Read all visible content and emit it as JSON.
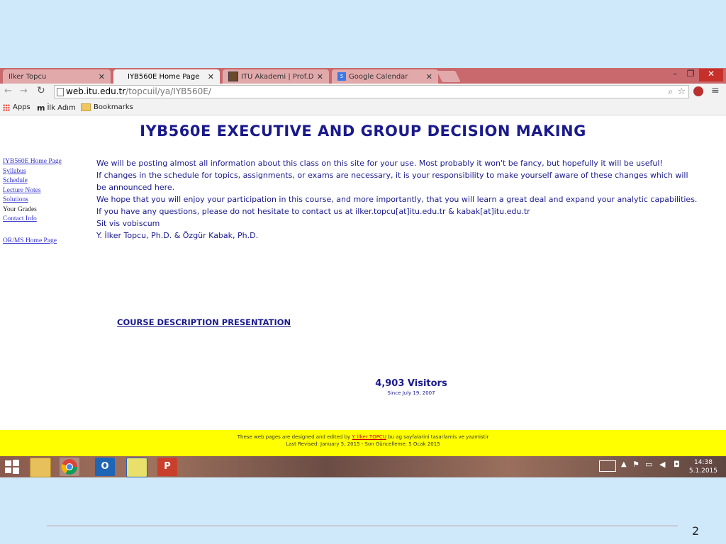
{
  "browser": {
    "tabs": [
      {
        "title": "Ilker Topcu",
        "active": false
      },
      {
        "title": "IYB560E Home Page",
        "active": true
      },
      {
        "title": "İTÜ Akademi | Prof.Dr. İlker",
        "active": false
      },
      {
        "title": "Google Calendar",
        "active": false
      }
    ],
    "address_host": "web.itu.edu.tr",
    "address_path": "/topcuil/ya/IYB560E/",
    "bookmarks": [
      "Apps",
      "İlk Adım",
      "Bookmarks"
    ]
  },
  "page": {
    "heading": "IYB560E EXECUTIVE AND GROUP DECISION MAKING",
    "nav": [
      {
        "label": "IYB560E Home Page",
        "link": true
      },
      {
        "label": "Syllabus",
        "link": true
      },
      {
        "label": "Schedule",
        "link": true
      },
      {
        "label": "Lecture Notes",
        "link": true
      },
      {
        "label": "Solutions",
        "link": true
      },
      {
        "label": "Your Grades",
        "link": false
      },
      {
        "label": "Contact Info",
        "link": true
      }
    ],
    "nav_home": "OR/MS Home Page",
    "paragraphs": [
      "We will be posting almost all information about this class on this site for your use. Most probably it won't be fancy, but hopefully it will be useful!",
      "If changes in the schedule for topics, assignments, or exams are necessary, it is your responsibility to make yourself aware of these changes which will be announced here.",
      "We hope that you will enjoy your participation in this course, and more importantly, that you will learn a great deal and expand your analytic capabilities.",
      "If you have any questions, please do not hesitate to contact us at ilker.topcu[at]itu.edu.tr & kabak[at]itu.edu.tr",
      "Sit vis vobiscum",
      "Y. İlker Topcu, Ph.D. & Özgür Kabak, Ph.D."
    ],
    "course_link": "COURSE DESCRIPTION PRESENTATION",
    "visitors": "4,903 Visitors",
    "since": "Since July 19, 2007",
    "footer_line1_pre": "These web pages are designed and edited by ",
    "footer_author": "Y. İlker TOPCU",
    "footer_line1_post": " bu ag sayfalarini tasarlamis ve yazmistir",
    "footer_line2": "Last Revised: January 5, 2015 - Son Güncelleme: 5 Ocak 2015"
  },
  "taskbar": {
    "time": "14:38",
    "date": "5.1.2015"
  },
  "slide": {
    "number": "2"
  },
  "colors": {
    "page_text": "#1a1a8c",
    "tabstrip": "#c9686d",
    "footer_bg": "#ffff00",
    "slide_bg": "#cfe8fa"
  }
}
